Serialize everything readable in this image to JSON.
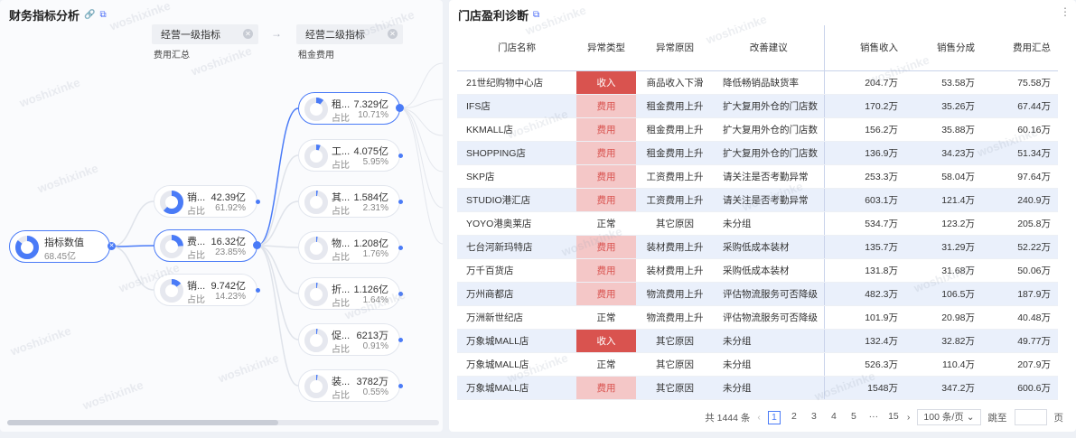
{
  "left": {
    "title": "财务指标分析",
    "link_icon": "link-icon",
    "copy_icon": "copy-icon",
    "level1": {
      "label": "经营一级指标",
      "sub": "费用汇总"
    },
    "level2": {
      "label": "经营二级指标",
      "sub": "租金费用"
    },
    "root": {
      "name": "指标数值",
      "value": "68.45亿",
      "ratio": 0.85
    },
    "mid": [
      {
        "name": "销...",
        "value": "42.39亿",
        "pct_label": "占比",
        "pct": "61.92%",
        "ratio": 0.6192
      },
      {
        "name": "费...",
        "value": "16.32亿",
        "pct_label": "占比",
        "pct": "23.85%",
        "ratio": 0.2385
      },
      {
        "name": "销...",
        "value": "9.742亿",
        "pct_label": "占比",
        "pct": "14.23%",
        "ratio": 0.1423
      }
    ],
    "right": [
      {
        "name": "租...",
        "value": "7.329亿",
        "pct_label": "占比",
        "pct": "10.71%",
        "ratio": 0.1071
      },
      {
        "name": "工...",
        "value": "4.075亿",
        "pct_label": "占比",
        "pct": "5.95%",
        "ratio": 0.0595
      },
      {
        "name": "其...",
        "value": "1.584亿",
        "pct_label": "占比",
        "pct": "2.31%",
        "ratio": 0.0231
      },
      {
        "name": "物...",
        "value": "1.208亿",
        "pct_label": "占比",
        "pct": "1.76%",
        "ratio": 0.0176
      },
      {
        "name": "折...",
        "value": "1.126亿",
        "pct_label": "占比",
        "pct": "1.64%",
        "ratio": 0.0164
      },
      {
        "name": "促...",
        "value": "6213万",
        "pct_label": "占比",
        "pct": "0.91%",
        "ratio": 0.0091
      },
      {
        "name": "装...",
        "value": "3782万",
        "pct_label": "占比",
        "pct": "0.55%",
        "ratio": 0.0055
      }
    ]
  },
  "right": {
    "title": "门店盈利诊断",
    "copy_icon": "copy-icon",
    "more_icon": "more-vertical-icon",
    "columns": [
      "门店名称",
      "异常类型",
      "异常原因",
      "改善建议",
      "销售收入",
      "销售分成",
      "费用汇总"
    ],
    "rows": [
      [
        "21世纪购物中心店",
        "收入",
        "商品收入下滑",
        "降低畅销品缺货率",
        "204.7万",
        "53.58万",
        "75.58万"
      ],
      [
        "IFS店",
        "费用",
        "租金费用上升",
        "扩大复用外仓的门店数",
        "170.2万",
        "35.26万",
        "67.44万"
      ],
      [
        "KKMALL店",
        "费用",
        "租金费用上升",
        "扩大复用外仓的门店数",
        "156.2万",
        "35.88万",
        "60.16万"
      ],
      [
        "SHOPPING店",
        "费用",
        "租金费用上升",
        "扩大复用外仓的门店数",
        "136.9万",
        "34.23万",
        "51.34万"
      ],
      [
        "SKP店",
        "费用",
        "工资费用上升",
        "请关注是否考勤异常",
        "253.3万",
        "58.04万",
        "97.64万"
      ],
      [
        "STUDIO港汇店",
        "费用",
        "工资费用上升",
        "请关注是否考勤异常",
        "603.1万",
        "121.4万",
        "240.9万"
      ],
      [
        "YOYO港奥莱店",
        "正常",
        "其它原因",
        "未分组",
        "534.7万",
        "123.2万",
        "205.8万"
      ],
      [
        "七台河新玛特店",
        "费用",
        "装材费用上升",
        "采购低成本装材",
        "135.7万",
        "31.29万",
        "52.22万"
      ],
      [
        "万千百货店",
        "费用",
        "装材费用上升",
        "采购低成本装材",
        "131.8万",
        "31.68万",
        "50.06万"
      ],
      [
        "万州商都店",
        "费用",
        "物流费用上升",
        "评估物流服务可否降级",
        "482.3万",
        "106.5万",
        "187.9万"
      ],
      [
        "万洲新世纪店",
        "正常",
        "物流费用上升",
        "评估物流服务可否降级",
        "101.9万",
        "20.98万",
        "40.48万"
      ],
      [
        "万象城MALL店",
        "收入",
        "其它原因",
        "未分组",
        "132.4万",
        "32.82万",
        "49.77万"
      ],
      [
        "万象城MALL店",
        "正常",
        "其它原因",
        "未分组",
        "526.3万",
        "110.4万",
        "207.9万"
      ],
      [
        "万象城MALL店",
        "费用",
        "其它原因",
        "未分组",
        "1548万",
        "347.2万",
        "600.6万"
      ]
    ],
    "pager": {
      "total": "共 1444 条",
      "pages": [
        "1",
        "2",
        "3",
        "4",
        "5",
        "···",
        "15"
      ],
      "page_size": "100 条/页",
      "jump_label": "跳至",
      "page_suffix": "页"
    }
  },
  "watermark": "woshixinke",
  "colors": {
    "accent": "#4a7bf7",
    "red": "#d9534f",
    "pink": "#f4c7c7",
    "stripe": "#eaf0fb"
  }
}
